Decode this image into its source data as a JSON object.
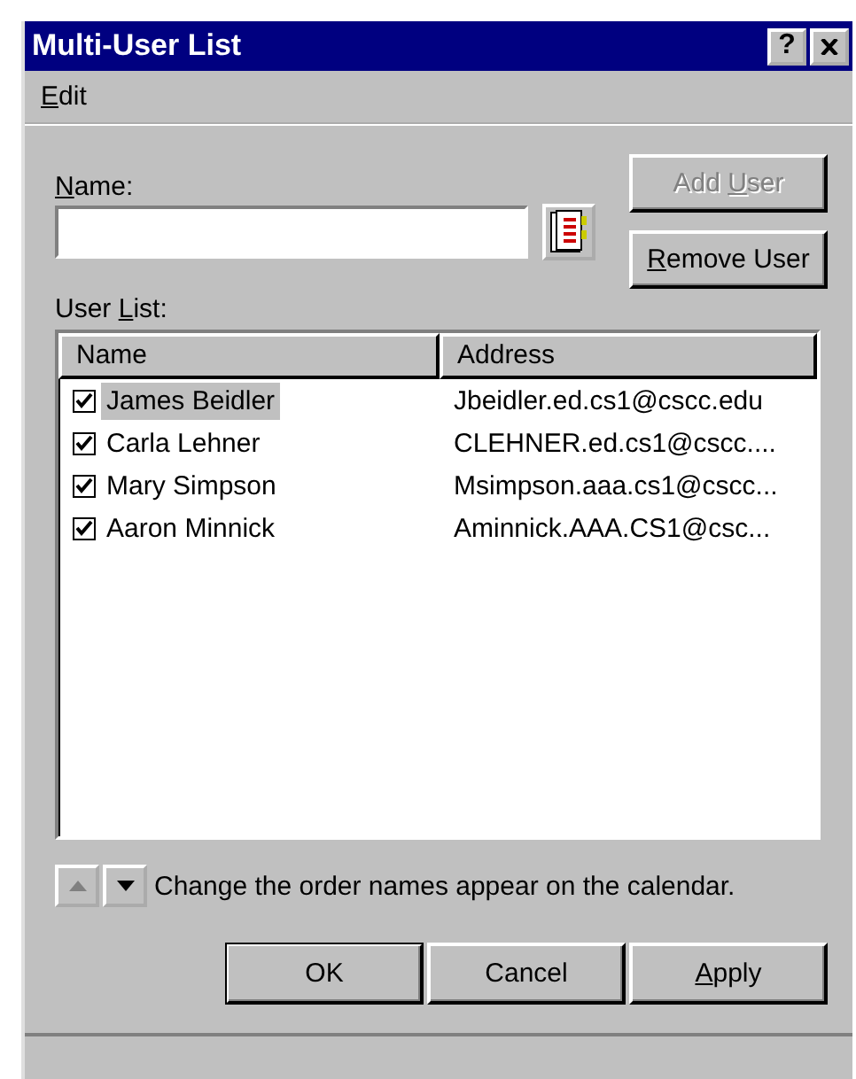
{
  "window": {
    "title": "Multi-User List",
    "controls": [
      {
        "kind": "help",
        "glyph": "?"
      },
      {
        "kind": "close"
      }
    ]
  },
  "menu": [
    {
      "label": [
        {
          "text": "E",
          "underlined": true
        },
        {
          "text": "dit",
          "underlined": false
        }
      ]
    }
  ],
  "name_field": {
    "label": [
      {
        "text": "N",
        "underlined": true
      },
      {
        "text": "ame:",
        "underlined": false
      }
    ]
  },
  "side_buttons": [
    {
      "label": [
        {
          "text": "Add ",
          "underlined": false
        },
        {
          "text": "U",
          "underlined": true
        },
        {
          "text": "ser",
          "underlined": false
        }
      ],
      "disabled": true
    },
    {
      "label": [
        {
          "text": "R",
          "underlined": true
        },
        {
          "text": "emove User",
          "underlined": false
        }
      ],
      "disabled": false
    }
  ],
  "user_list": {
    "label": [
      {
        "text": "User ",
        "underlined": false
      },
      {
        "text": "L",
        "underlined": true
      },
      {
        "text": "ist:",
        "underlined": false
      }
    ],
    "columns": [
      "Name",
      "Address"
    ],
    "rows": [
      {
        "name": "James Beidler",
        "address": "Jbeidler.ed.cs1@cscc.edu",
        "checked": true,
        "selected": true
      },
      {
        "name": "Carla Lehner",
        "address": "CLEHNER.ed.cs1@cscc....",
        "checked": true,
        "selected": false
      },
      {
        "name": "Mary Simpson",
        "address": "Msimpson.aaa.cs1@cscc...",
        "checked": true,
        "selected": false
      },
      {
        "name": "Aaron Minnick",
        "address": "Aminnick.AAA.CS1@csc...",
        "checked": true,
        "selected": false
      }
    ]
  },
  "order": {
    "up_disabled": true,
    "down_disabled": false,
    "hint": "Change the order names appear on the calendar."
  },
  "buttons": [
    {
      "label": [
        {
          "text": "OK",
          "underlined": false
        }
      ],
      "default": true
    },
    {
      "label": [
        {
          "text": "Cancel",
          "underlined": false
        }
      ],
      "default": false
    },
    {
      "label": [
        {
          "text": "A",
          "underlined": true
        },
        {
          "text": "pply",
          "underlined": false
        }
      ],
      "default": false
    }
  ]
}
